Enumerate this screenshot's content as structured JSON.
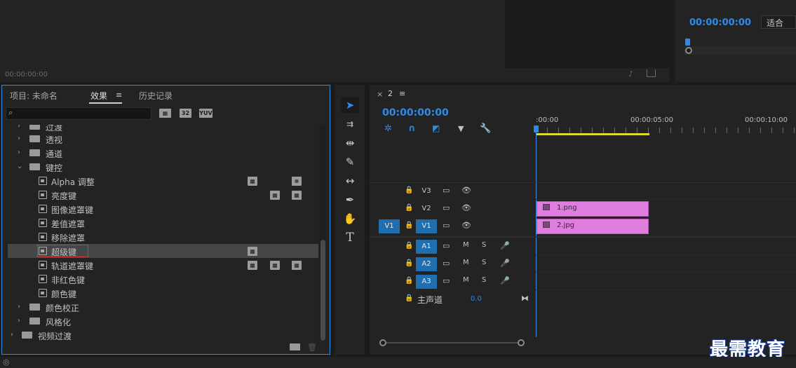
{
  "source_monitor": {
    "timecode": "00:00:00:00"
  },
  "program_monitor": {
    "timecode": "00:00:00:00",
    "fit_label": "适合"
  },
  "effects_panel": {
    "tabs": [
      "项目: 未命名",
      "效果",
      "历史记录"
    ],
    "active_tab": "效果",
    "search_placeholder": "",
    "filter_badges": [
      "32",
      "YUV"
    ],
    "tree": [
      {
        "type": "folder",
        "label": "过渡",
        "expanded": false
      },
      {
        "type": "folder",
        "label": "透视",
        "expanded": false
      },
      {
        "type": "folder",
        "label": "通道",
        "expanded": false
      },
      {
        "type": "folder",
        "label": "键控",
        "expanded": true
      },
      {
        "type": "effect",
        "label": "Alpha 调整",
        "badges": [
          "accel",
          "yuv"
        ]
      },
      {
        "type": "effect",
        "label": "亮度键",
        "badges": [
          "32",
          "yuv"
        ]
      },
      {
        "type": "effect",
        "label": "图像遮罩键",
        "badges": []
      },
      {
        "type": "effect",
        "label": "差值遮罩",
        "badges": []
      },
      {
        "type": "effect",
        "label": "移除遮罩",
        "badges": []
      },
      {
        "type": "effect",
        "label": "超级键",
        "badges": [
          "accel"
        ],
        "selected": true
      },
      {
        "type": "effect",
        "label": "轨道遮罩键",
        "badges": [
          "accel",
          "32",
          "yuv"
        ]
      },
      {
        "type": "effect",
        "label": "非红色键",
        "badges": []
      },
      {
        "type": "effect",
        "label": "颜色键",
        "badges": []
      },
      {
        "type": "folder",
        "label": "颜色校正",
        "expanded": false
      },
      {
        "type": "folder",
        "label": "风格化",
        "expanded": false
      },
      {
        "type": "folder-root",
        "label": "视频过渡",
        "expanded": false
      }
    ]
  },
  "timeline": {
    "sequence_tab": "2",
    "timecode": "00:00:00:00",
    "ruler_labels": [
      ":00:00",
      "00:00:05:00",
      "00:00:10:00"
    ],
    "tracks": [
      {
        "name": "V3",
        "kind": "video",
        "clip": ""
      },
      {
        "name": "V2",
        "kind": "video",
        "clip": "1.png"
      },
      {
        "name": "V1",
        "kind": "video",
        "clip": "2.jpg",
        "source": "V1"
      },
      {
        "name": "A1",
        "kind": "audio"
      },
      {
        "name": "A2",
        "kind": "audio"
      },
      {
        "name": "A3",
        "kind": "audio"
      }
    ],
    "mute_label": "M",
    "solo_label": "S",
    "master": {
      "label": "主声道",
      "value": "0.0"
    }
  },
  "watermark": "最需教育",
  "colors": {
    "accent": "#2d8ceb",
    "clip": "#e07ee0",
    "work_area": "#e3d633"
  }
}
